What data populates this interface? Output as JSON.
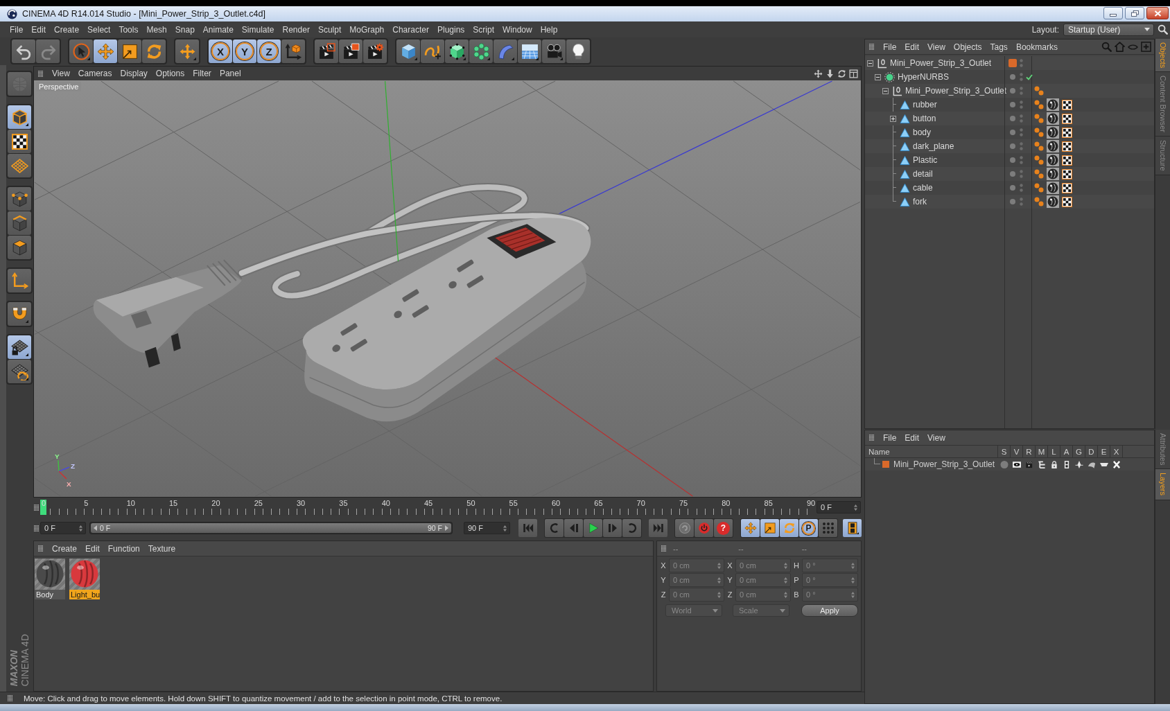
{
  "window": {
    "title": "CINEMA 4D R14.014 Studio - [Mini_Power_Strip_3_Outlet.c4d]"
  },
  "menu_bar": [
    "File",
    "Edit",
    "Create",
    "Select",
    "Tools",
    "Mesh",
    "Snap",
    "Animate",
    "Simulate",
    "Render",
    "Sculpt",
    "MoGraph",
    "Character",
    "Plugins",
    "Script",
    "Window",
    "Help"
  ],
  "layout": {
    "label": "Layout:",
    "value": "Startup (User)"
  },
  "toolbar": [
    [
      {
        "selected": false,
        "disabled": false
      },
      {
        "selected": false,
        "disabled": true
      }
    ],
    [
      {
        "selected": false,
        "disabled": false
      },
      {
        "selected": true,
        "disabled": false
      },
      {
        "selected": false,
        "disabled": false
      },
      {
        "selected": false,
        "disabled": false
      }
    ],
    [
      {
        "selected": false,
        "disabled": false
      }
    ],
    [
      {
        "label": "X",
        "selected": true,
        "disabled": false
      },
      {
        "label": "Y",
        "selected": true,
        "disabled": false
      },
      {
        "label": "Z",
        "selected": true,
        "disabled": false
      },
      {
        "selected": false,
        "disabled": false
      }
    ],
    [
      {
        "selected": false,
        "disabled": false
      },
      {
        "selected": false,
        "disabled": false
      },
      {
        "selected": false,
        "disabled": false
      }
    ],
    [
      {
        "selected": false,
        "disabled": false
      },
      {
        "selected": false,
        "disabled": false
      },
      {
        "selected": false,
        "disabled": false
      },
      {
        "selected": false,
        "disabled": false
      },
      {
        "selected": false,
        "disabled": false
      },
      {
        "selected": false,
        "disabled": false
      },
      {
        "selected": false,
        "disabled": false
      },
      {
        "selected": false,
        "disabled": false
      }
    ]
  ],
  "tool_palette": [
    [
      {
        "selected": false,
        "disabled": true
      }
    ],
    [
      {
        "selected": true,
        "disabled": false
      },
      {
        "selected": false,
        "disabled": false
      },
      {
        "selected": false,
        "disabled": false
      }
    ],
    [
      {
        "selected": false,
        "disabled": false
      },
      {
        "selected": false,
        "disabled": false
      },
      {
        "selected": false,
        "disabled": false
      }
    ],
    [
      {
        "selected": false,
        "disabled": false
      }
    ],
    [
      {
        "selected": false,
        "disabled": false
      }
    ],
    [
      {
        "selected": true,
        "disabled": false
      },
      {
        "selected": false,
        "disabled": false
      }
    ]
  ],
  "logo": {
    "brand": "MAXON",
    "product": "CINEMA 4D"
  },
  "viewport": {
    "menu": [
      "View",
      "Cameras",
      "Display",
      "Options",
      "Filter",
      "Panel"
    ],
    "camera": "Perspective",
    "axis_labels": [
      "Y",
      "Z",
      "X"
    ]
  },
  "timeline": {
    "ticks": [
      "0",
      "5",
      "10",
      "15",
      "20",
      "25",
      "30",
      "35",
      "40",
      "45",
      "50",
      "55",
      "60",
      "65",
      "70",
      "75",
      "80",
      "85",
      "90"
    ],
    "level": 0,
    "current_frame": "0 F"
  },
  "frame_range": {
    "start": "0 F",
    "range_start": "0 F",
    "range_end": "90 F",
    "end": "90 F",
    "level": 1
  },
  "keying": [
    [
      {
        "selected": false
      },
      {
        "selected": false
      },
      {
        "selected": false,
        "label": "?"
      }
    ],
    [
      {
        "selected": true
      },
      {
        "selected": true
      },
      {
        "selected": true
      },
      {
        "selected": true,
        "label": "P"
      },
      {
        "selected": false
      }
    ],
    [
      {
        "selected": true
      }
    ]
  ],
  "material_manager": {
    "menu": [
      "Create",
      "Edit",
      "Function",
      "Texture"
    ],
    "materials": [
      {
        "name": "Body",
        "color": "#4a4a4a",
        "selected": false
      },
      {
        "name": "Light_bu",
        "color": "#d9393d",
        "selected": true
      }
    ]
  },
  "coordinates": {
    "headers": [
      "--",
      "--",
      "--"
    ],
    "rows": [
      [
        {
          "label": "X",
          "value": "0 cm"
        },
        {
          "label": "X",
          "value": "0 cm"
        },
        {
          "label": "H",
          "value": "0 °"
        }
      ],
      [
        {
          "label": "Y",
          "value": "0 cm"
        },
        {
          "label": "Y",
          "value": "0 cm"
        },
        {
          "label": "P",
          "value": "0 °"
        }
      ],
      [
        {
          "label": "Z",
          "value": "0 cm"
        },
        {
          "label": "Z",
          "value": "0 cm"
        },
        {
          "label": "B",
          "value": "0 °"
        }
      ]
    ],
    "dropdowns": [
      {
        "value": "World",
        "disabled": true
      },
      {
        "value": "Scale",
        "disabled": true
      }
    ],
    "apply": "Apply"
  },
  "object_manager": {
    "menu": [
      "File",
      "Edit",
      "View",
      "Objects",
      "Tags",
      "Bookmarks"
    ],
    "tree": [
      {
        "name": "Mini_Power_Strip_3_Outlet",
        "kind": "null",
        "expanded": true,
        "color": "#d9692a",
        "children": [
          {
            "name": "HyperNURBS",
            "kind": "hypernurbs",
            "expanded": true,
            "enabled": true,
            "children": [
              {
                "name": "Mini_Power_Strip_3_Outlet",
                "kind": "null",
                "expanded": true,
                "tags": [
                  {
                    "kind": "phong"
                  }
                ],
                "children": [
                  {
                    "name": "rubber",
                    "kind": "polygon",
                    "tags": [
                      {
                        "kind": "phong"
                      },
                      {
                        "kind": "material"
                      },
                      {
                        "kind": "uvw"
                      }
                    ]
                  },
                  {
                    "name": "button",
                    "kind": "polygon",
                    "expanded": false,
                    "tags": [
                      {
                        "kind": "phong"
                      },
                      {
                        "kind": "material"
                      },
                      {
                        "kind": "uvw"
                      }
                    ]
                  },
                  {
                    "name": "body",
                    "kind": "polygon",
                    "tags": [
                      {
                        "kind": "phong"
                      },
                      {
                        "kind": "material"
                      },
                      {
                        "kind": "uvw"
                      }
                    ]
                  },
                  {
                    "name": "dark_plane",
                    "kind": "polygon",
                    "tags": [
                      {
                        "kind": "phong"
                      },
                      {
                        "kind": "material"
                      },
                      {
                        "kind": "uvw"
                      }
                    ]
                  },
                  {
                    "name": "Plastic",
                    "kind": "polygon",
                    "tags": [
                      {
                        "kind": "phong"
                      },
                      {
                        "kind": "material"
                      },
                      {
                        "kind": "uvw"
                      }
                    ]
                  },
                  {
                    "name": "detail",
                    "kind": "polygon",
                    "tags": [
                      {
                        "kind": "phong"
                      },
                      {
                        "kind": "material"
                      },
                      {
                        "kind": "uvw"
                      }
                    ]
                  },
                  {
                    "name": "cable",
                    "kind": "polygon",
                    "tags": [
                      {
                        "kind": "phong"
                      },
                      {
                        "kind": "material"
                      },
                      {
                        "kind": "uvw"
                      }
                    ]
                  },
                  {
                    "name": "fork",
                    "kind": "polygon",
                    "tags": [
                      {
                        "kind": "phong"
                      },
                      {
                        "kind": "material"
                      },
                      {
                        "kind": "uvw"
                      }
                    ]
                  }
                ]
              }
            ]
          }
        ]
      }
    ]
  },
  "layer_manager": {
    "menu": [
      "File",
      "Edit",
      "View"
    ],
    "columns": [
      "Name",
      "S",
      "V",
      "R",
      "M",
      "L",
      "A",
      "G",
      "D",
      "E",
      "X"
    ],
    "layers": [
      {
        "name": "Mini_Power_Strip_3_Outlet",
        "color": "#d9692a"
      }
    ]
  },
  "side_tabs": {
    "upper": [
      {
        "label": "Objects",
        "selected": true
      },
      {
        "label": "Content Browser",
        "selected": false
      },
      {
        "label": "Structure",
        "selected": false
      }
    ],
    "lower": [
      {
        "label": "Attributes",
        "selected": false
      },
      {
        "label": "Layers",
        "selected": true
      }
    ]
  },
  "status_bar": "Move: Click and drag to move elements. Hold down SHIFT to quantize movement / add to the selection in point mode, CTRL to remove."
}
